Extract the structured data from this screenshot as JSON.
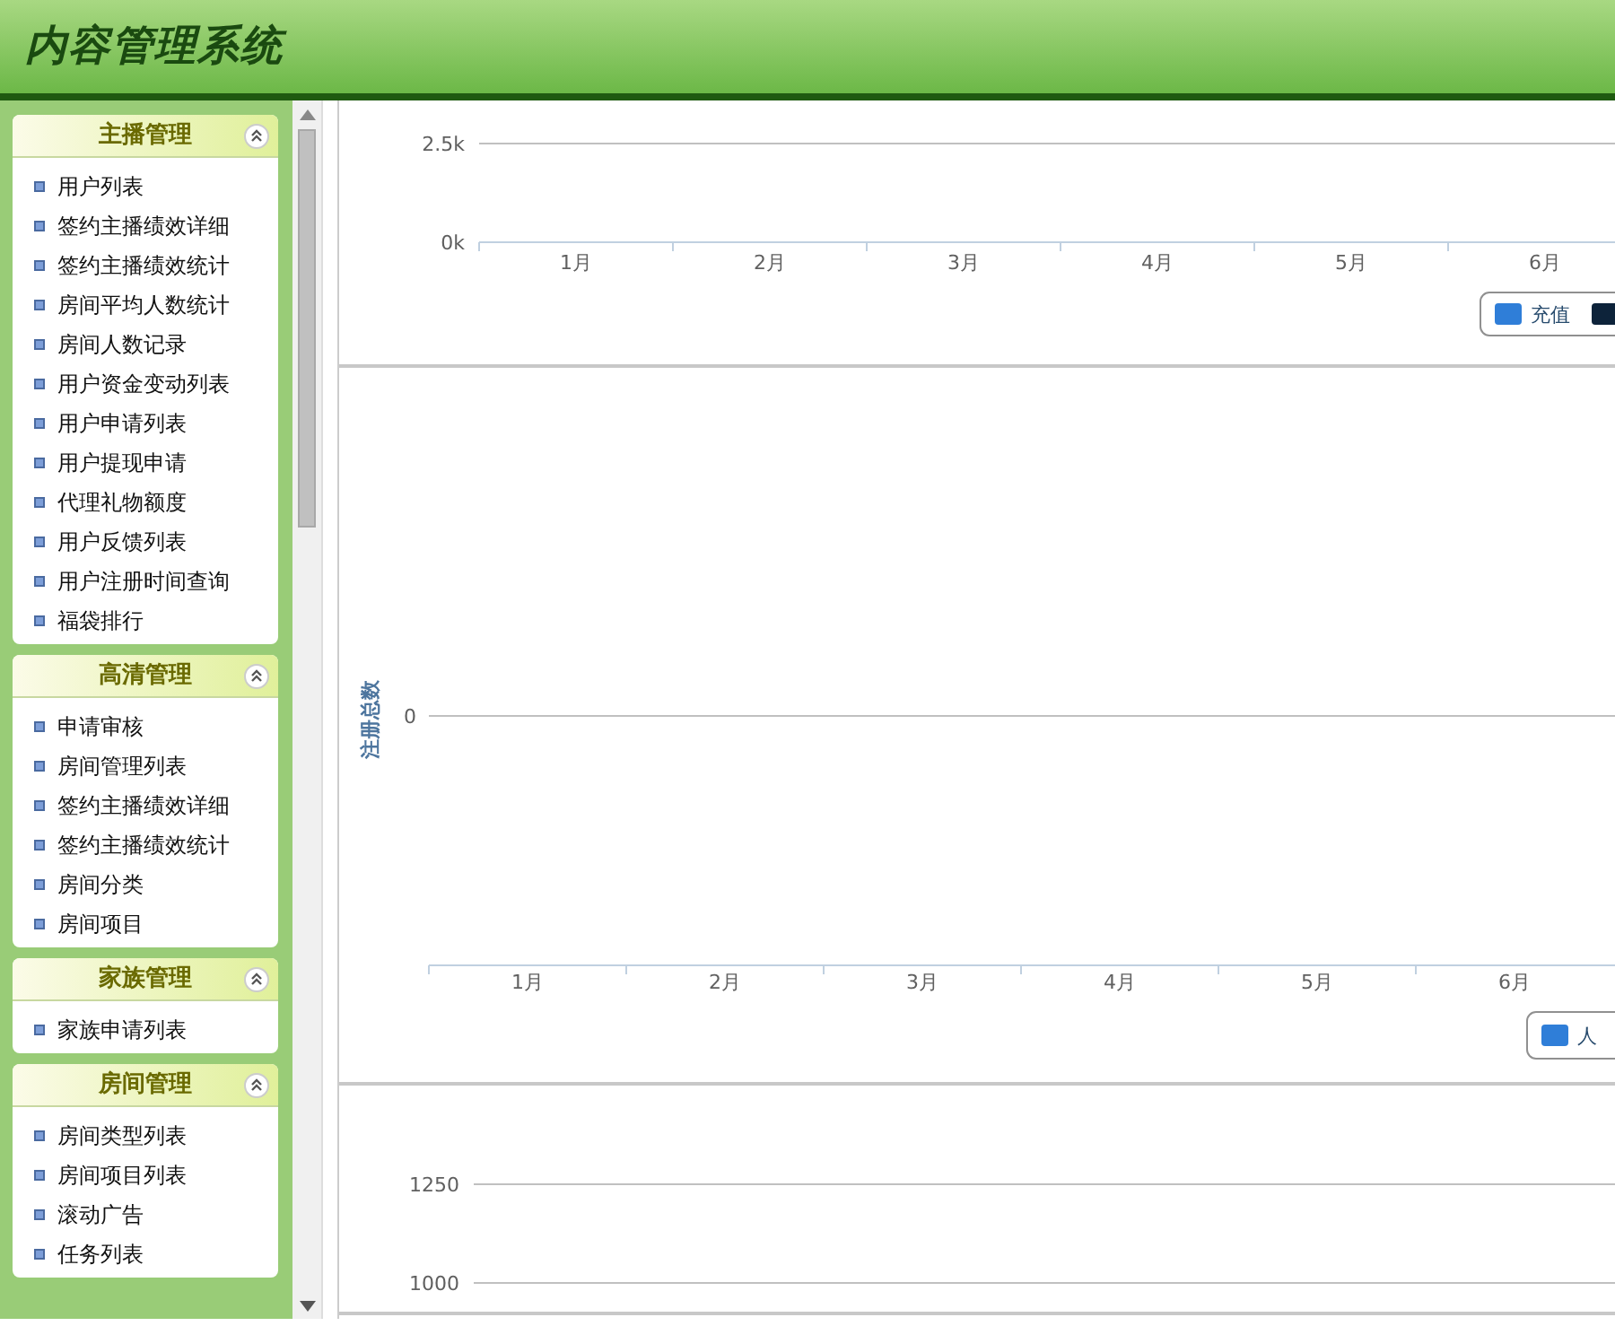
{
  "header": {
    "title": "内容管理系统"
  },
  "sidebar": {
    "groups": [
      {
        "title": "主播管理",
        "items": [
          "用户列表",
          "签约主播绩效详细",
          "签约主播绩效统计",
          "房间平均人数统计",
          "房间人数记录",
          "用户资金变动列表",
          "用户申请列表",
          "用户提现申请",
          "代理礼物额度",
          "用户反馈列表",
          "用户注册时间查询",
          "福袋排行"
        ]
      },
      {
        "title": "高清管理",
        "items": [
          "申请审核",
          "房间管理列表",
          "签约主播绩效详细",
          "签约主播绩效统计",
          "房间分类",
          "房间项目"
        ]
      },
      {
        "title": "家族管理",
        "items": [
          "家族申请列表"
        ]
      },
      {
        "title": "房间管理",
        "items": [
          "房间类型列表",
          "房间项目列表",
          "滚动广告",
          "任务列表"
        ]
      }
    ]
  },
  "charts": [
    {
      "y_labels": [
        "2.5k",
        "0k"
      ],
      "x_labels": [
        "1月",
        "2月",
        "3月",
        "4月",
        "5月",
        "6月"
      ],
      "legend": [
        {
          "name": "充值",
          "color": "#2f7ed8"
        },
        {
          "color": "#0d233a"
        }
      ]
    },
    {
      "y_title": "注册总数",
      "y_labels": [
        "0"
      ],
      "x_labels": [
        "1月",
        "2月",
        "3月",
        "4月",
        "5月",
        "6月"
      ],
      "legend": [
        {
          "name": "人",
          "color": "#2f7ed8"
        }
      ]
    },
    {
      "y_labels": [
        "1250",
        "1000"
      ]
    }
  ]
}
